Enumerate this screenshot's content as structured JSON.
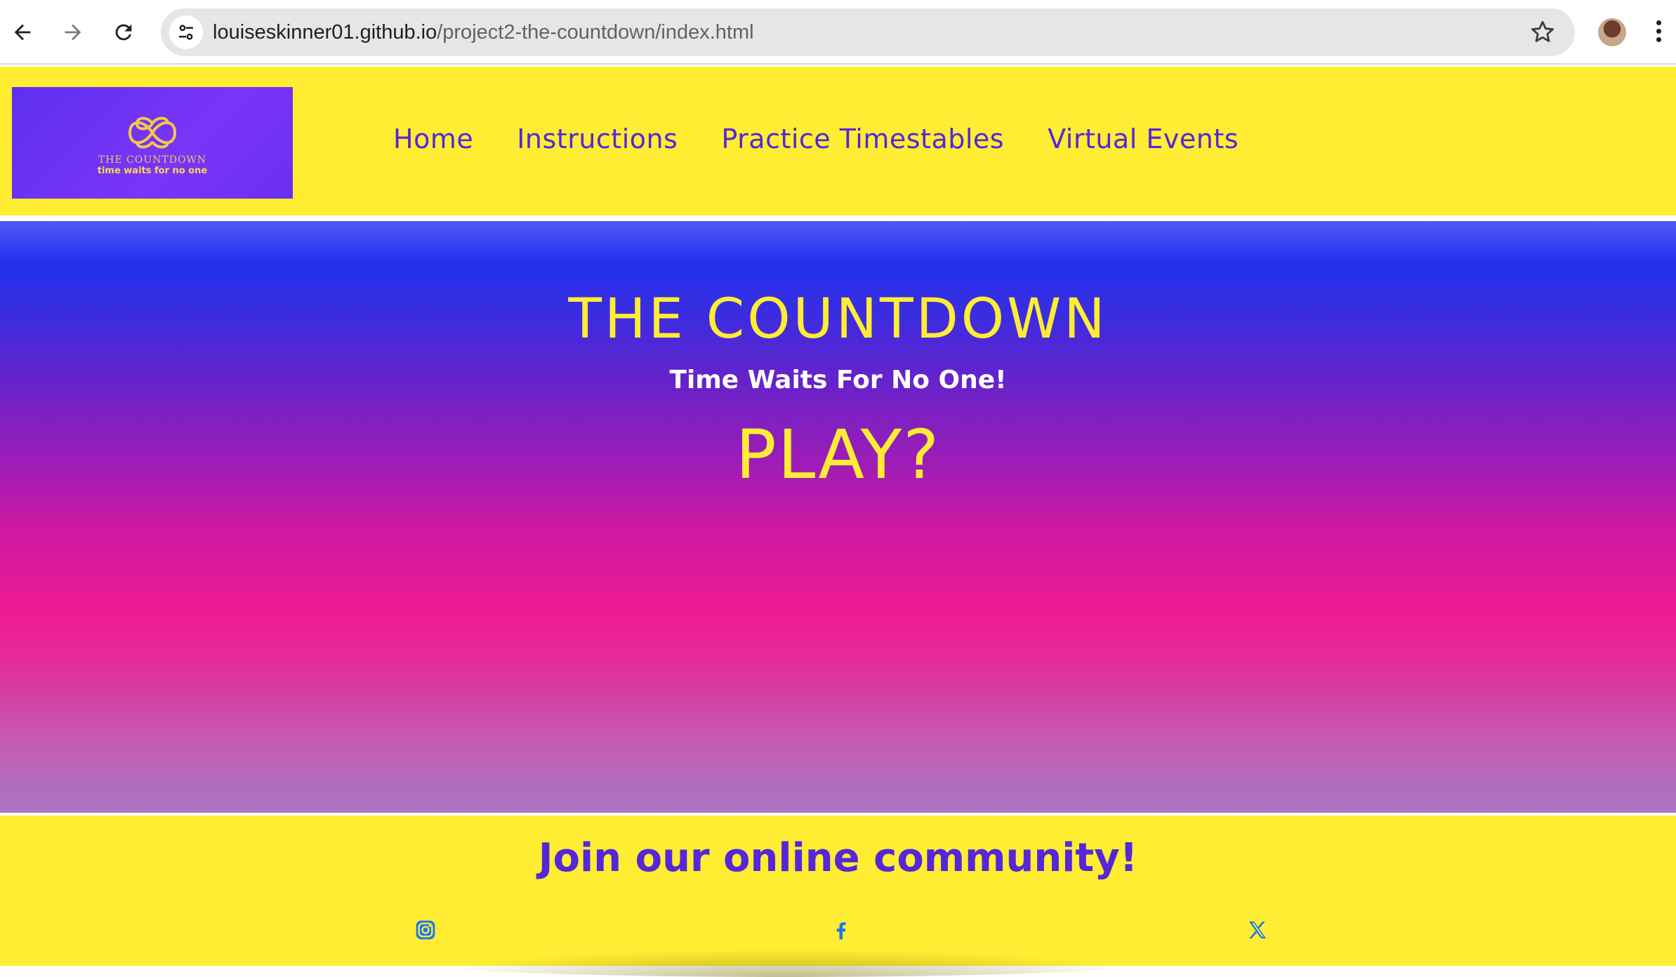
{
  "browser": {
    "url_host": "louiseskinner01.github.io",
    "url_path": "/project2-the-countdown/index.html",
    "icons": {
      "back": "back-arrow-icon",
      "forward": "forward-arrow-icon",
      "reload": "reload-icon",
      "site_info": "tune-icon",
      "bookmark": "star-icon",
      "profile": "avatar",
      "menu": "kebab-menu-icon"
    }
  },
  "header": {
    "logo": {
      "name": "THE COUNTDOWN",
      "tagline": "time waits for no one"
    },
    "nav": [
      {
        "label": "Home"
      },
      {
        "label": "Instructions"
      },
      {
        "label": "Practice Timestables"
      },
      {
        "label": "Virtual Events"
      }
    ]
  },
  "hero": {
    "title": "THE COUNTDOWN",
    "subtitle": "Time Waits For No One!",
    "play": "PLAY?"
  },
  "footer": {
    "title": "Join our online community!",
    "social": [
      {
        "icon": "instagram-icon"
      },
      {
        "icon": "facebook-icon"
      },
      {
        "icon": "x-twitter-icon"
      }
    ]
  },
  "colors": {
    "yellow": "#ffed33",
    "purple": "#5427d8",
    "hero_top": "#2131ec",
    "hero_mid": "#ef1a92",
    "hero_bottom": "#ab76c2",
    "social_blue": "#1877f2"
  }
}
